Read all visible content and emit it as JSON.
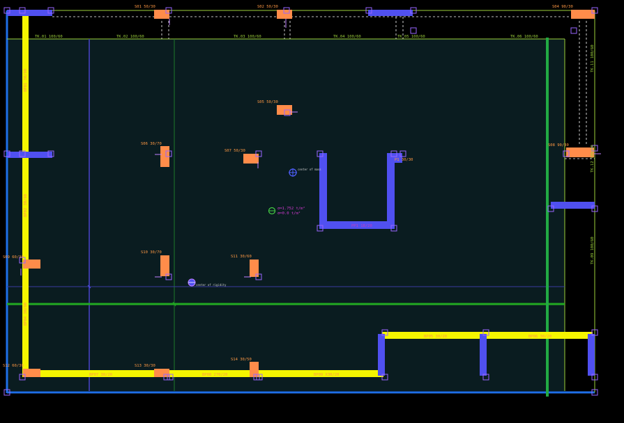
{
  "colors": {
    "background": "#000000",
    "slab": "#0a1c20",
    "wall_blue": "#5050f0",
    "wall_yellow": "#f5f500",
    "column_orange": "#ff8c4a",
    "grid_green": "#22aa22",
    "border_blue": "#1f6fe8",
    "marker_purple": "#9966ff",
    "text_orange": "#ff9944",
    "text_green": "#9ccf3a",
    "text_magenta": "#c040c0"
  },
  "grid_labels": {
    "tk01": "TK.01 100/60",
    "tk02": "TK.02 100/60",
    "tk03": "TK.03 100/60",
    "tk04": "TK.04 100/60",
    "tk05": "TK.05 100/60",
    "tk06": "TK.06 100/60",
    "tk11": "TK.11 100/60",
    "tk12": "TK.12 100/60",
    "tk09": "TK.09 100/60"
  },
  "columns": {
    "s01": "S01 50/30",
    "s02": "S02 50/30",
    "s04": "S04 90/30",
    "s05": "S05 50/30",
    "s06": "S06 30/70",
    "s07": "S07 50/30",
    "s08": "S08 90/30",
    "s09": "S09 60/30",
    "s10": "S10 30/70",
    "s11": "S11 30/60",
    "s12": "S12 60/30",
    "s13": "S13 30/30",
    "s14": "S14 30/50"
  },
  "walls": {
    "bp01": "BP01 30/90",
    "bp02": "BP02 30/90",
    "bp03": "BP03 30/90",
    "bp04": "BP04 30/90",
    "bp05": "BP05 30/20",
    "bp06": "BP06 30/20",
    "bp07": "BP07 30/20",
    "bp08": "BP08 270/20",
    "bp09": "BP09 X30/20",
    "pc": "P1 30/30",
    "ushape_bottom": "PP1 18/20",
    "ushape_left": "P1 20",
    "ushape_right": "P1 20"
  },
  "annotations": {
    "mass_center": "center of mass",
    "rigidity_center": "center of rigidity",
    "stress_line1": "σ=1.752 t/m²",
    "stress_line2": "σ=0.0 t/m²"
  }
}
